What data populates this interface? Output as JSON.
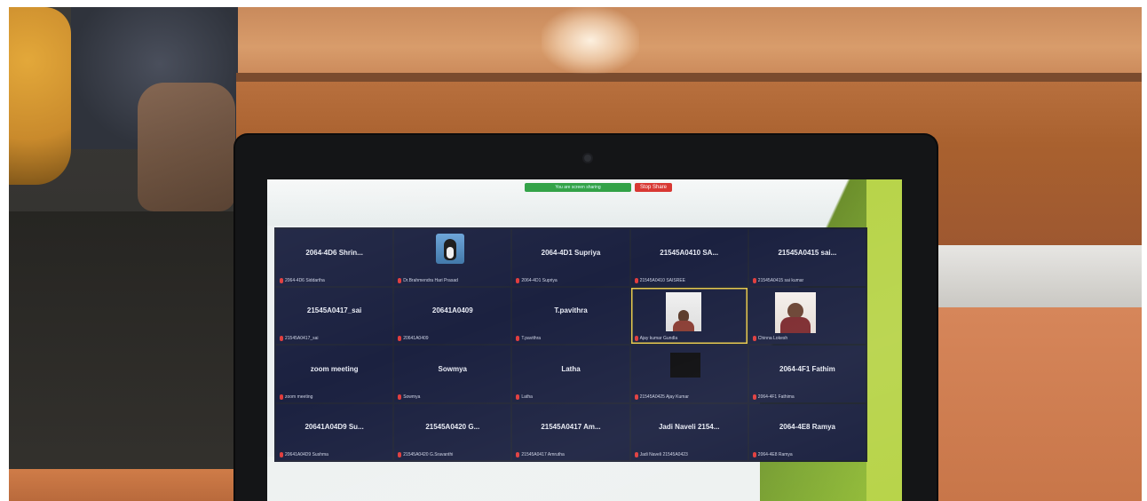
{
  "scene": {
    "subject": "laptop showing video meeting gallery"
  },
  "meeting": {
    "share_bar": {
      "sharing_label": "You are screen sharing",
      "stop_label": "Stop Share"
    },
    "tiles": [
      {
        "name": "2064-4D6 Shrin...",
        "label": "2064-4D6 Siddartha",
        "type": "name"
      },
      {
        "name": "",
        "label": "Dr.Brahmendra Hari Prasad",
        "type": "penguin"
      },
      {
        "name": "2064-4D1 Supriya",
        "label": "2064-4D1 Supriya",
        "type": "name"
      },
      {
        "name": "21545A0410 SA...",
        "label": "21545A0410 SAISREE",
        "type": "name"
      },
      {
        "name": "21545A0415 sai...",
        "label": "21545A0415 sai kumar",
        "type": "name"
      },
      {
        "name": "21545A0417_sai",
        "label": "21545A0417_sai",
        "type": "name"
      },
      {
        "name": "20641A0409",
        "label": "20641A0409",
        "type": "name"
      },
      {
        "name": "T.pavithra",
        "label": "T.pavithra",
        "type": "name"
      },
      {
        "name": "",
        "label": "Ajay kumar Gundla",
        "type": "video1"
      },
      {
        "name": "",
        "label": "Chinna Lokesh",
        "type": "video2"
      },
      {
        "name": "zoom meeting",
        "label": "zoom meeting",
        "type": "name"
      },
      {
        "name": "Sowmya",
        "label": "Sowmya",
        "type": "name"
      },
      {
        "name": "Latha",
        "label": "Latha",
        "type": "name"
      },
      {
        "name": "",
        "label": "21545A0425 Ajay Kumar",
        "type": "logo"
      },
      {
        "name": "2064-4F1 Fathim",
        "label": "2064-4F1 Fathima",
        "type": "name"
      },
      {
        "name": "20641A04D9 Su...",
        "label": "20641A04D9 Sushma",
        "type": "name"
      },
      {
        "name": "21545A0420 G...",
        "label": "21545A0420 G.Sravanthi",
        "type": "name"
      },
      {
        "name": "21545A0417 Am...",
        "label": "21545A0417 Amrutha",
        "type": "name"
      },
      {
        "name": "Jadi Naveli 2154...",
        "label": "Jadi Naveli 21545A0423",
        "type": "name"
      },
      {
        "name": "2064-4E8 Ramya",
        "label": "2064-4E8 Ramya",
        "type": "name"
      }
    ]
  }
}
